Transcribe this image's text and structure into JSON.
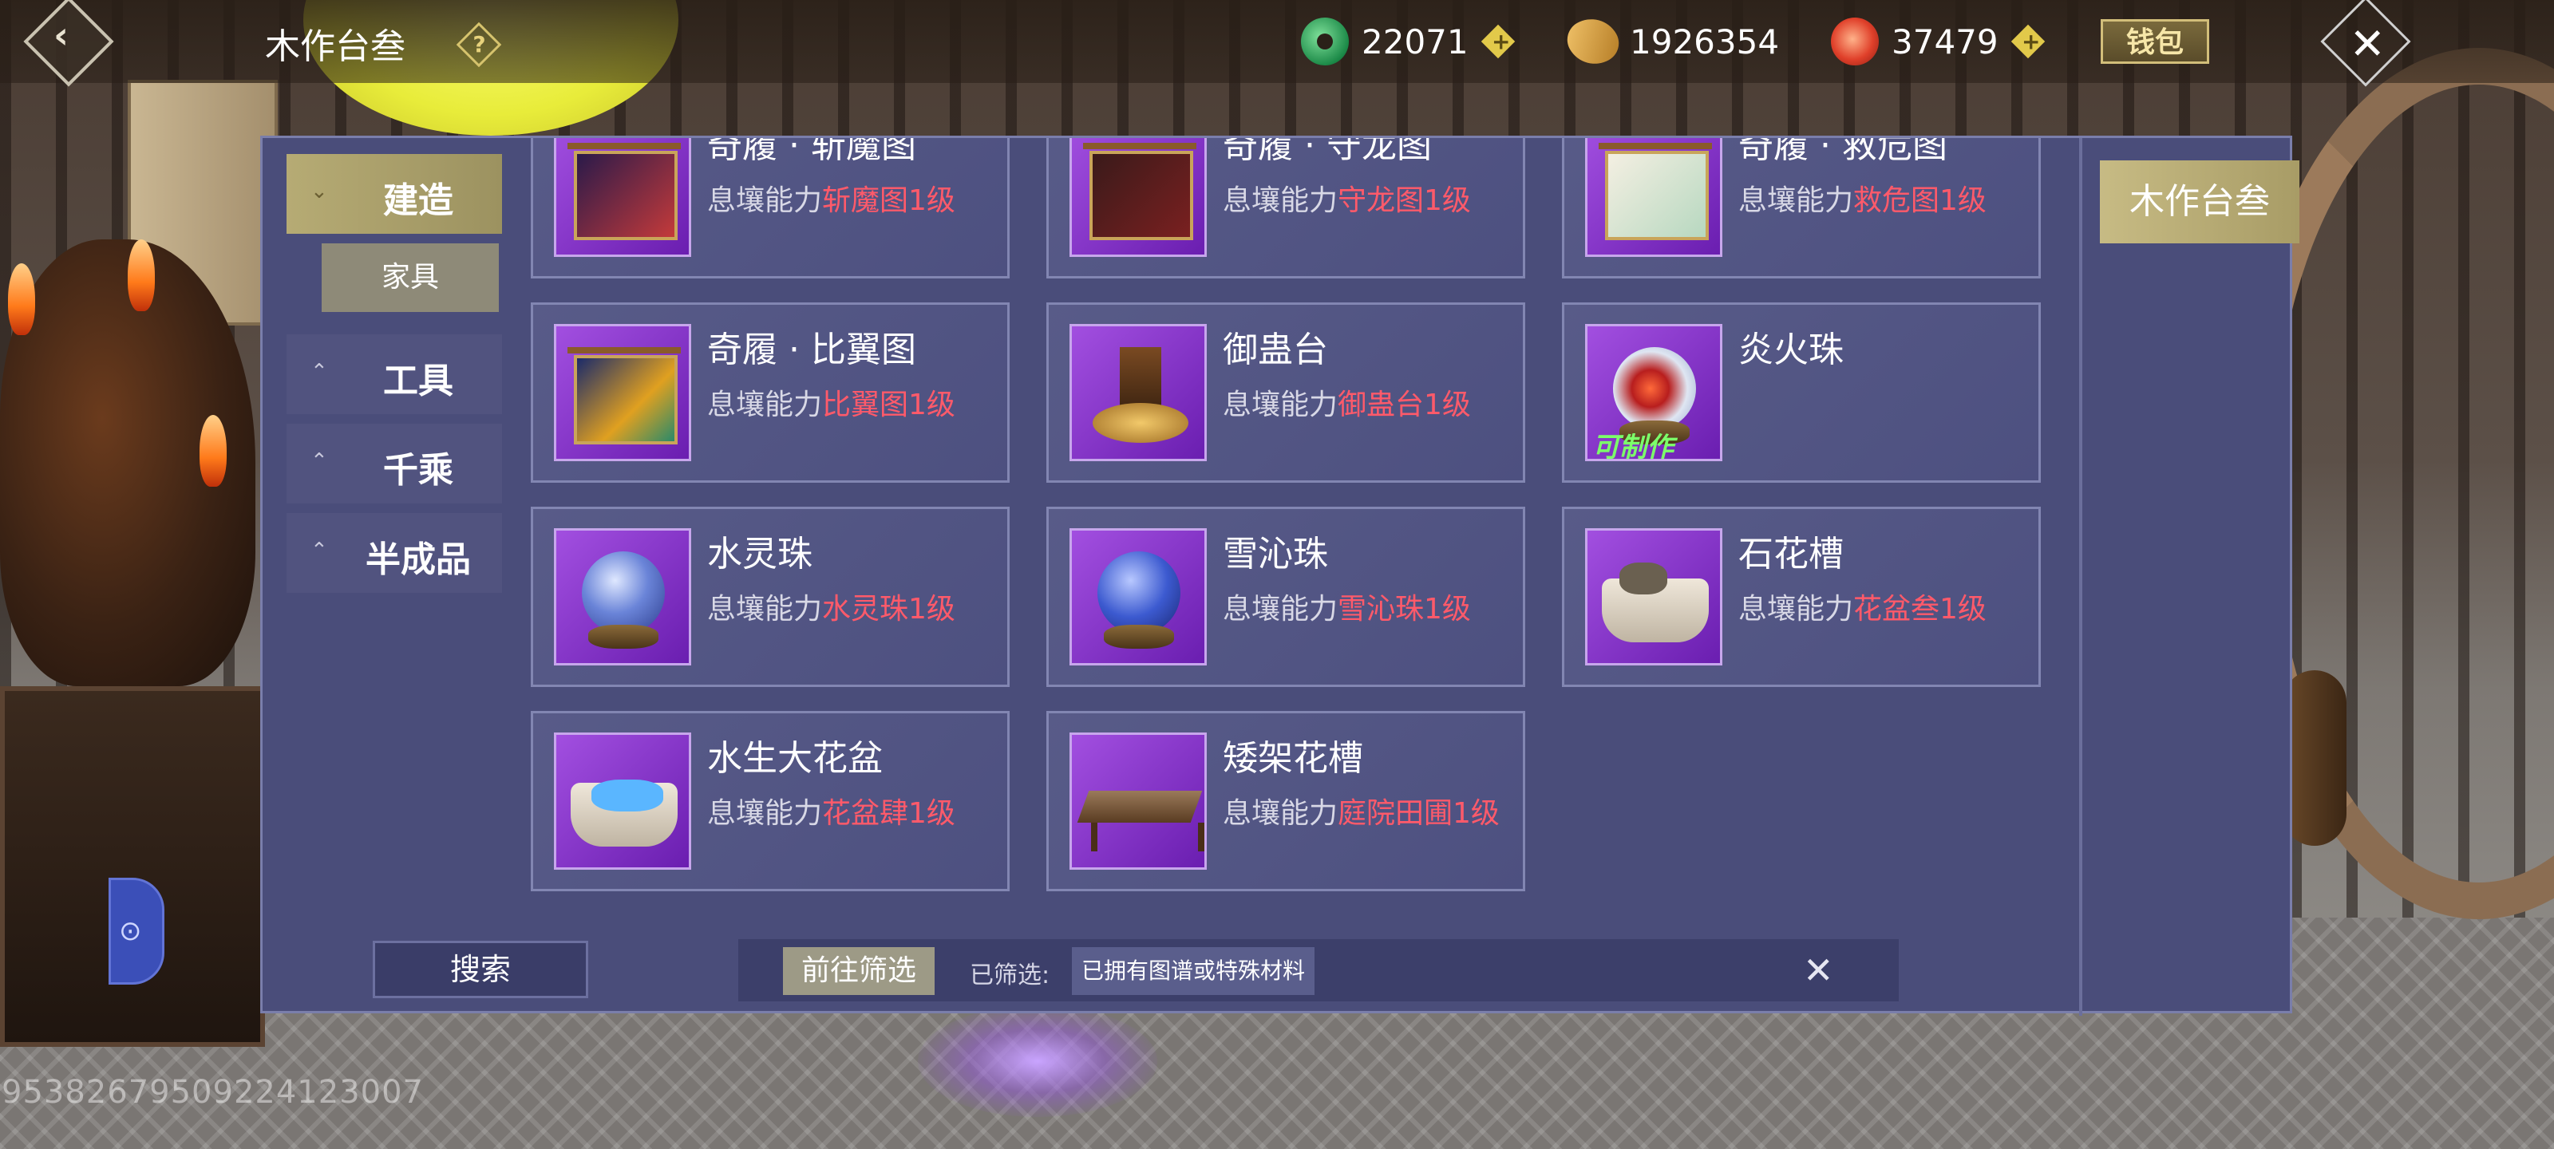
{
  "header": {
    "title": "木作台叁",
    "help_icon": "question-icon",
    "currencies": [
      {
        "icon": "jade-coin-icon",
        "value": "22071"
      },
      {
        "icon": "leaf-coin-icon",
        "value": "1926354"
      },
      {
        "icon": "swirl-coin-icon",
        "value": "37479"
      }
    ],
    "wallet_label": "钱包"
  },
  "left_nav": {
    "categories": [
      {
        "label": "建造",
        "active": true
      },
      {
        "label": "工具",
        "active": false
      },
      {
        "label": "千乘",
        "active": false
      },
      {
        "label": "半成品",
        "active": false
      }
    ],
    "sub_items": [
      {
        "label": "家具"
      }
    ]
  },
  "items": [
    {
      "name": "奇履 · 斩魔图",
      "req_prefix": "息壤能力",
      "req_value": "斩魔图1级"
    },
    {
      "name": "奇履 · 守龙图",
      "req_prefix": "息壤能力",
      "req_value": "守龙图1级"
    },
    {
      "name": "奇履 · 救危图",
      "req_prefix": "息壤能力",
      "req_value": "救危图1级"
    },
    {
      "name": "奇履 · 比翼图",
      "req_prefix": "息壤能力",
      "req_value": "比翼图1级"
    },
    {
      "name": "御蛊台",
      "req_prefix": "息壤能力",
      "req_value": "御蛊台1级"
    },
    {
      "name": "炎火珠",
      "req_prefix": "",
      "req_value": "",
      "badge": "可制作"
    },
    {
      "name": "水灵珠",
      "req_prefix": "息壤能力",
      "req_value": "水灵珠1级"
    },
    {
      "name": "雪沁珠",
      "req_prefix": "息壤能力",
      "req_value": "雪沁珠1级"
    },
    {
      "name": "石花槽",
      "req_prefix": "息壤能力",
      "req_value": "花盆叁1级"
    },
    {
      "name": "水生大花盆",
      "req_prefix": "息壤能力",
      "req_value": "花盆肆1级"
    },
    {
      "name": "矮架花槽",
      "req_prefix": "息壤能力",
      "req_value": "庭院田圃1级"
    }
  ],
  "bottom": {
    "search_label": "搜索",
    "goto_filter_label": "前往筛选",
    "filtered_label": "已筛选:",
    "filter_tag": "已拥有图谱或特殊材料"
  },
  "right_tab": {
    "label": "木作台叁"
  },
  "uid": "9538267950922412300​7"
}
